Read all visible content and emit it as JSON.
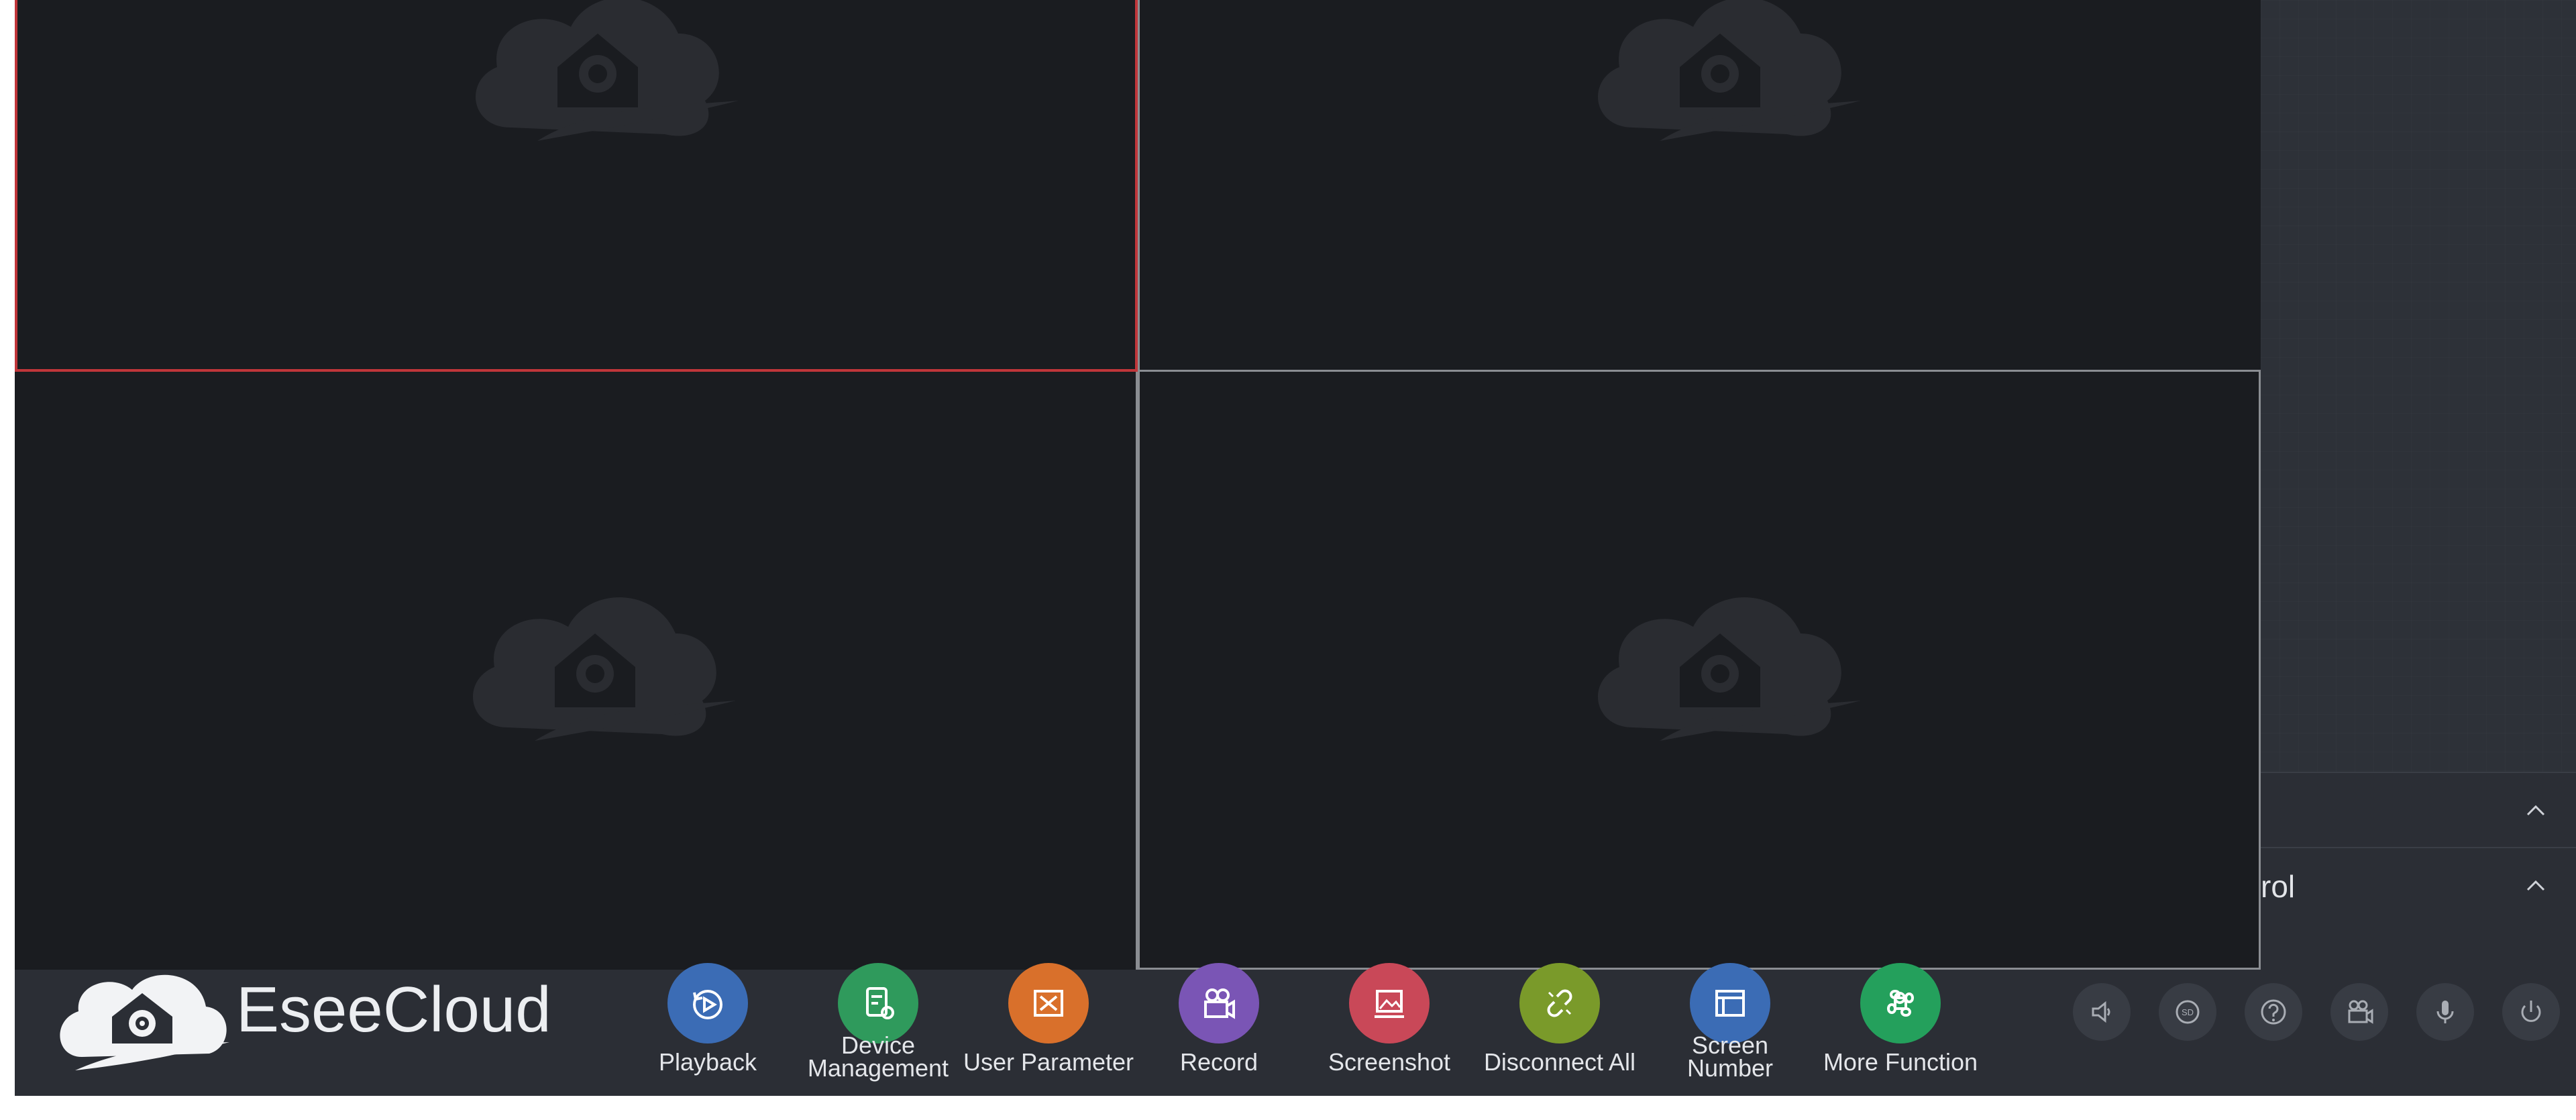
{
  "app": {
    "brand_name": "EseeCloud"
  },
  "side_panel": {
    "section_1_label": "",
    "section_2_label": "rol"
  },
  "toolbar": {
    "items": [
      {
        "label": "Playback",
        "icon": "playback-icon",
        "color": "#3b6cb5"
      },
      {
        "label": "Device\nManagement",
        "icon": "device-management-icon",
        "color": "#2f9a5c"
      },
      {
        "label": "User Parameter",
        "icon": "user-parameter-icon",
        "color": "#d9702b"
      },
      {
        "label": "Record",
        "icon": "record-icon",
        "color": "#7a55b5"
      },
      {
        "label": "Screenshot",
        "icon": "screenshot-icon",
        "color": "#c94858"
      },
      {
        "label": "Disconnect All",
        "icon": "disconnect-icon",
        "color": "#7a9a2a"
      },
      {
        "label": "Screen\nNumber",
        "icon": "screen-number-icon",
        "color": "#3b6cb5"
      },
      {
        "label": "More Function",
        "icon": "more-function-icon",
        "color": "#24a05c"
      }
    ],
    "controls": [
      {
        "icon": "volume-icon"
      },
      {
        "icon": "sd-icon",
        "text": "SD"
      },
      {
        "icon": "help-icon"
      },
      {
        "icon": "video-record-icon"
      },
      {
        "icon": "microphone-icon"
      },
      {
        "icon": "power-icon"
      }
    ]
  },
  "colors": {
    "active_cell_border": "#c0363a",
    "cell_border": "#8a8d92",
    "toolbar_bg": "#2b2e35",
    "video_bg": "#1a1c20"
  }
}
